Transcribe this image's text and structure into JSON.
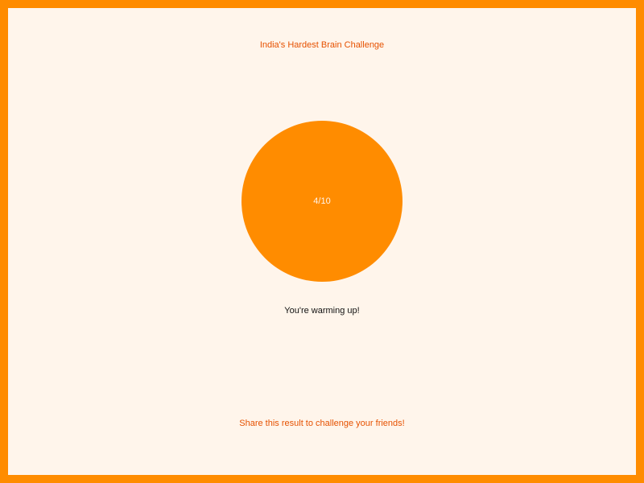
{
  "header": {
    "title": "India's Hardest Brain Challenge"
  },
  "result": {
    "score": "4/10",
    "message": "You're warming up!"
  },
  "footer": {
    "share_text": "Share this result to challenge your friends!"
  },
  "colors": {
    "accent": "#ff8c00",
    "background": "#fff5eb",
    "title_text": "#e65100",
    "message_text": "#111111"
  }
}
